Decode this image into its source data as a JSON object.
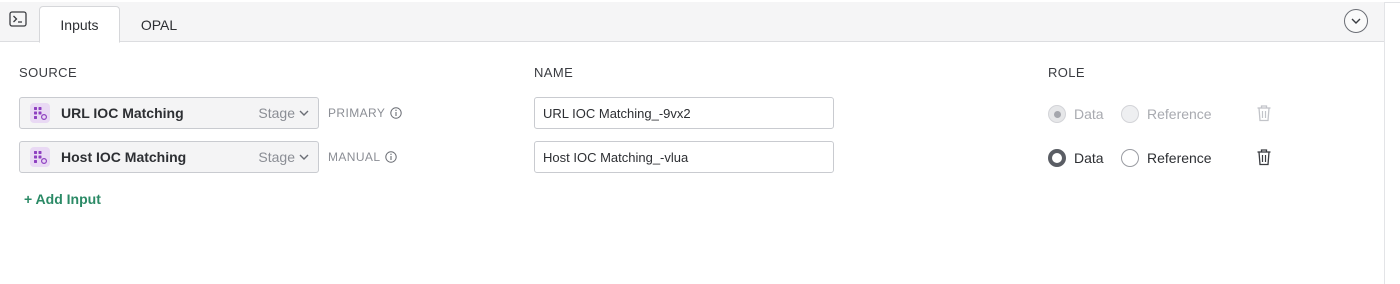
{
  "tabs": [
    {
      "label": "Inputs",
      "active": true
    },
    {
      "label": "OPAL",
      "active": false
    }
  ],
  "columns": {
    "source": "SOURCE",
    "name": "NAME",
    "role": "ROLE"
  },
  "inputs": [
    {
      "source_label": "URL IOC Matching",
      "source_type": "Stage",
      "kind": "PRIMARY",
      "name_value": "URL IOC Matching_-9vx2",
      "role_selected": "Data",
      "role_options": [
        "Data",
        "Reference"
      ],
      "disabled": true
    },
    {
      "source_label": "Host IOC Matching",
      "source_type": "Stage",
      "kind": "MANUAL",
      "name_value": "Host IOC Matching_-vlua",
      "role_selected": "Data",
      "role_options": [
        "Data",
        "Reference"
      ],
      "disabled": false
    }
  ],
  "add_input_label": "+ Add Input",
  "icons": {
    "tabbar_left": "terminal-icon",
    "tabbar_right": "chevron-down-circle-icon",
    "source": "grid-stage-icon",
    "kind_info": "info-icon",
    "row_action": "trash-icon"
  },
  "colors": {
    "accent_green": "#2b8a66",
    "source_icon_bg": "#e9d9f4",
    "source_icon_fg": "#8e3fc1"
  }
}
